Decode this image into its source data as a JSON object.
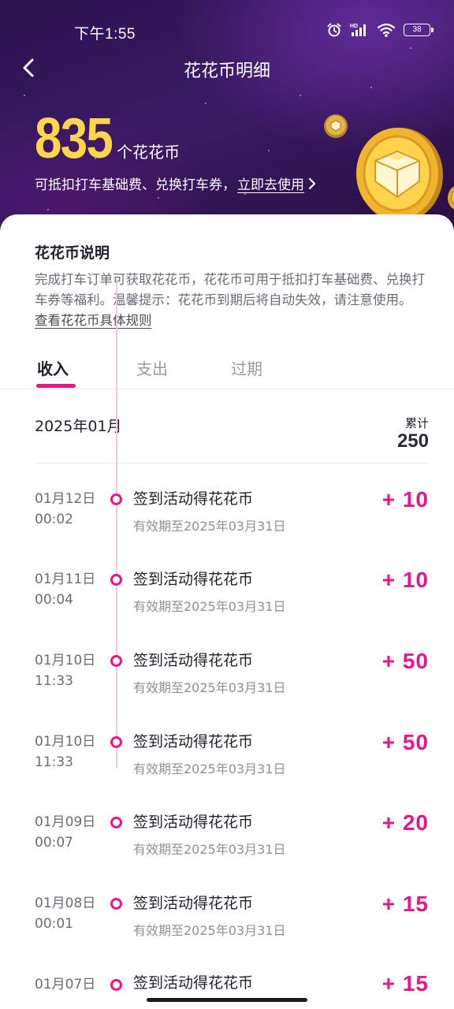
{
  "status_bar": {
    "time": "下午1:55",
    "battery": "38"
  },
  "nav": {
    "title": "花花币明细"
  },
  "balance": {
    "amount": "835",
    "unit": "个花花币",
    "description": "可抵扣打车基础费、兑换打车券，",
    "link": "立即去使用"
  },
  "info": {
    "title": "花花币说明",
    "text": "完成打车订单可获取花花币，花花币可用于抵扣打车基础费、兑换打车券等福利。温馨提示：花花币到期后将自动失效，请注意使用。",
    "rules_link": "查看花花币具体规则"
  },
  "tabs": [
    {
      "label": "收入",
      "active": true
    },
    {
      "label": "支出",
      "active": false
    },
    {
      "label": "过期",
      "active": false
    }
  ],
  "summary": {
    "month": "2025年01月",
    "total_label": "累计",
    "total_value": "250"
  },
  "entries": [
    {
      "date": "01月12日",
      "time": "00:02",
      "title": "签到活动得花花币",
      "expiry": "有效期至2025年03月31日",
      "amount": "+ 10"
    },
    {
      "date": "01月11日",
      "time": "00:04",
      "title": "签到活动得花花币",
      "expiry": "有效期至2025年03月31日",
      "amount": "+ 10"
    },
    {
      "date": "01月10日",
      "time": "11:33",
      "title": "签到活动得花花币",
      "expiry": "有效期至2025年03月31日",
      "amount": "+ 50"
    },
    {
      "date": "01月10日",
      "time": "11:33",
      "title": "签到活动得花花币",
      "expiry": "有效期至2025年03月31日",
      "amount": "+ 50"
    },
    {
      "date": "01月09日",
      "time": "00:07",
      "title": "签到活动得花花币",
      "expiry": "有效期至2025年03月31日",
      "amount": "+ 20"
    },
    {
      "date": "01月08日",
      "time": "00:01",
      "title": "签到活动得花花币",
      "expiry": "有效期至2025年03月31日",
      "amount": "+ 15"
    },
    {
      "date": "01月07日",
      "time": "",
      "title": "签到活动得花花币",
      "expiry": "",
      "amount": "+ 15"
    }
  ],
  "colors": {
    "accent": "#e8168c",
    "gold": "#ffd54a",
    "header_bg": "#2c1250"
  },
  "icons": [
    "back-arrow-icon",
    "alarm-icon",
    "signal-icon",
    "wifi-icon",
    "battery-icon",
    "chevron-right-icon",
    "coin-icon"
  ]
}
